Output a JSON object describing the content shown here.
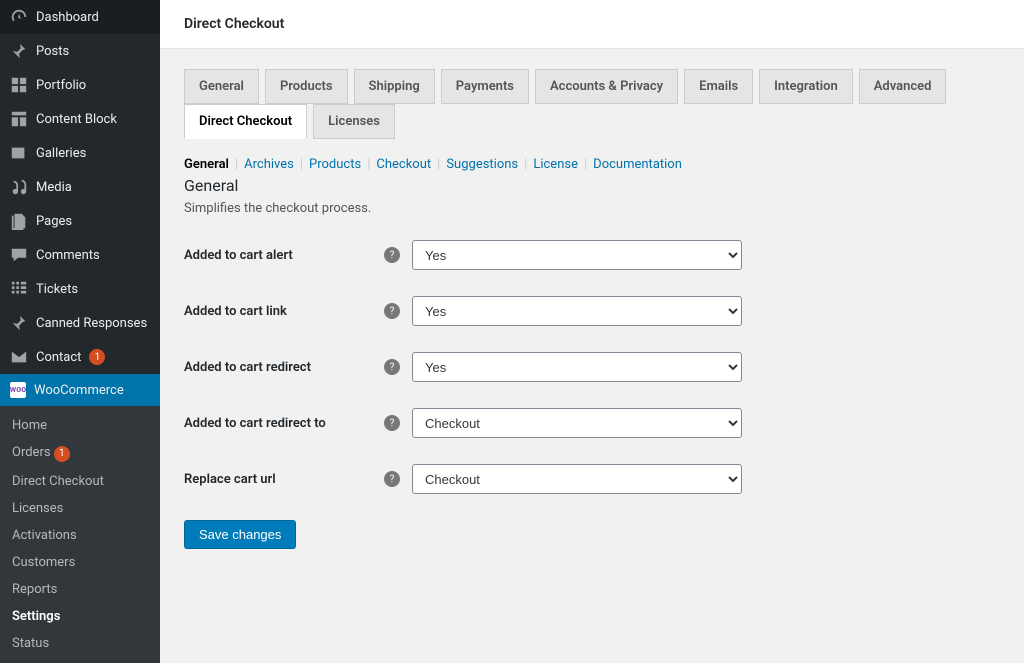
{
  "sidebar": {
    "items": [
      {
        "name": "dashboard",
        "label": "Dashboard",
        "icon": "gauge"
      },
      {
        "name": "posts",
        "label": "Posts",
        "icon": "pin"
      },
      {
        "name": "portfolio",
        "label": "Portfolio",
        "icon": "grid"
      },
      {
        "name": "content-block",
        "label": "Content Block",
        "icon": "layout"
      },
      {
        "name": "galleries",
        "label": "Galleries",
        "icon": "images"
      },
      {
        "name": "media",
        "label": "Media",
        "icon": "media"
      },
      {
        "name": "pages",
        "label": "Pages",
        "icon": "pages"
      },
      {
        "name": "comments",
        "label": "Comments",
        "icon": "comment"
      },
      {
        "name": "tickets",
        "label": "Tickets",
        "icon": "tickets"
      },
      {
        "name": "canned-responses",
        "label": "Canned Responses",
        "icon": "pin"
      },
      {
        "name": "contact",
        "label": "Contact",
        "icon": "mail",
        "badge": "1"
      },
      {
        "name": "woocommerce",
        "label": "WooCommerce",
        "icon": "woo",
        "active": true
      }
    ],
    "submenu": [
      {
        "name": "home",
        "label": "Home"
      },
      {
        "name": "orders",
        "label": "Orders",
        "badge": "1"
      },
      {
        "name": "direct-checkout",
        "label": "Direct Checkout"
      },
      {
        "name": "licenses",
        "label": "Licenses"
      },
      {
        "name": "activations",
        "label": "Activations"
      },
      {
        "name": "customers",
        "label": "Customers"
      },
      {
        "name": "reports",
        "label": "Reports"
      },
      {
        "name": "settings",
        "label": "Settings",
        "current": true
      },
      {
        "name": "status",
        "label": "Status"
      }
    ]
  },
  "header": {
    "title": "Direct Checkout"
  },
  "tabs": [
    {
      "name": "general",
      "label": "General"
    },
    {
      "name": "products",
      "label": "Products"
    },
    {
      "name": "shipping",
      "label": "Shipping"
    },
    {
      "name": "payments",
      "label": "Payments"
    },
    {
      "name": "accounts-privacy",
      "label": "Accounts & Privacy"
    },
    {
      "name": "emails",
      "label": "Emails"
    },
    {
      "name": "integration",
      "label": "Integration"
    },
    {
      "name": "advanced",
      "label": "Advanced"
    },
    {
      "name": "direct-checkout",
      "label": "Direct Checkout",
      "active": true
    },
    {
      "name": "licenses",
      "label": "Licenses"
    }
  ],
  "subtabs": [
    {
      "name": "general",
      "label": "General",
      "active": true
    },
    {
      "name": "archives",
      "label": "Archives"
    },
    {
      "name": "products",
      "label": "Products"
    },
    {
      "name": "checkout",
      "label": "Checkout"
    },
    {
      "name": "suggestions",
      "label": "Suggestions"
    },
    {
      "name": "license",
      "label": "License"
    },
    {
      "name": "documentation",
      "label": "Documentation"
    }
  ],
  "section": {
    "title": "General",
    "desc": "Simplifies the checkout process."
  },
  "form": {
    "rows": [
      {
        "name": "added-to-cart-alert",
        "label": "Added to cart alert",
        "value": "Yes"
      },
      {
        "name": "added-to-cart-link",
        "label": "Added to cart link",
        "value": "Yes"
      },
      {
        "name": "added-to-cart-redirect",
        "label": "Added to cart redirect",
        "value": "Yes"
      },
      {
        "name": "added-to-cart-redirect-to",
        "label": "Added to cart redirect to",
        "value": "Checkout"
      },
      {
        "name": "replace-cart-url",
        "label": "Replace cart url",
        "value": "Checkout"
      }
    ],
    "save_label": "Save changes"
  }
}
